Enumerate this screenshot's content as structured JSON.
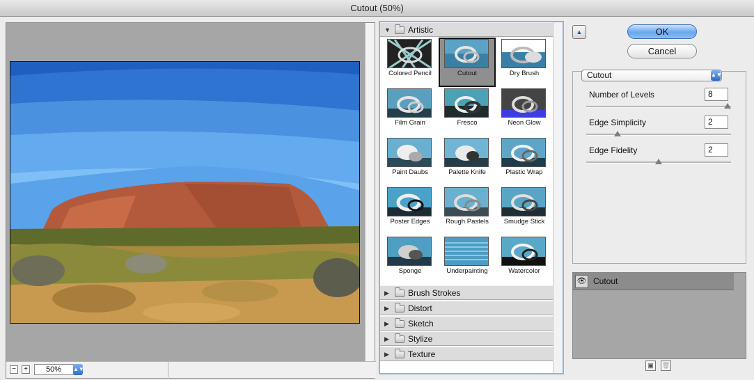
{
  "window": {
    "title": "Cutout (50%)"
  },
  "preview": {
    "zoom_value": "50%",
    "zoom_out_symbol": "−",
    "zoom_in_symbol": "+",
    "zoom_icon": "zoom-stepper-icon"
  },
  "gallery": {
    "categories": [
      {
        "label": "Artistic",
        "expanded": true
      },
      {
        "label": "Brush Strokes",
        "expanded": false
      },
      {
        "label": "Distort",
        "expanded": false
      },
      {
        "label": "Sketch",
        "expanded": false
      },
      {
        "label": "Stylize",
        "expanded": false
      },
      {
        "label": "Texture",
        "expanded": false
      }
    ],
    "thumbnails": [
      {
        "label": "Colored Pencil"
      },
      {
        "label": "Cutout",
        "selected": true
      },
      {
        "label": "Dry Brush"
      },
      {
        "label": "Film Grain"
      },
      {
        "label": "Fresco"
      },
      {
        "label": "Neon Glow"
      },
      {
        "label": "Paint Daubs"
      },
      {
        "label": "Palette Knife"
      },
      {
        "label": "Plastic Wrap"
      },
      {
        "label": "Poster Edges"
      },
      {
        "label": "Rough Pastels"
      },
      {
        "label": "Smudge Stick"
      },
      {
        "label": "Sponge"
      },
      {
        "label": "Underpainting"
      },
      {
        "label": "Watercolor"
      }
    ]
  },
  "buttons": {
    "ok": "OK",
    "cancel": "Cancel"
  },
  "settings": {
    "filter_name": "Cutout",
    "params": [
      {
        "label": "Number of Levels",
        "value": "8",
        "min": 2,
        "max": 8
      },
      {
        "label": "Edge Simplicity",
        "value": "2",
        "min": 0,
        "max": 10
      },
      {
        "label": "Edge Fidelity",
        "value": "2",
        "min": 1,
        "max": 3
      }
    ]
  },
  "layers": {
    "items": [
      {
        "name": "Cutout"
      }
    ],
    "visibility_icon": "eye-icon"
  },
  "colors": {
    "accent": "#3d6fb8",
    "selection_border": "#8db3e2"
  }
}
